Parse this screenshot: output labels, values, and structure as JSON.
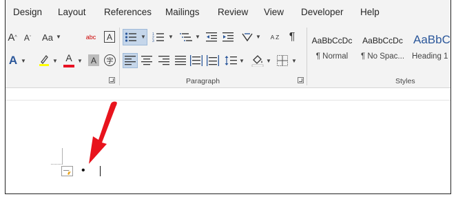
{
  "tabs": [
    "Design",
    "Layout",
    "References",
    "Mailings",
    "Review",
    "View",
    "Developer",
    "Help"
  ],
  "font_group": {
    "change_case_label": "Aa",
    "clear_formatting_label": "abc",
    "char_border_label": "A",
    "text_effects_label": "A",
    "font_color_label": "A",
    "char_shading_label": "A",
    "enclose_label": "字"
  },
  "paragraph_group": {
    "label": "Paragraph",
    "sort_label": "A Z",
    "show_marks_label": "¶"
  },
  "styles_group": {
    "label": "Styles",
    "items": [
      {
        "sample": "AaBbCcDc",
        "name": "¶ Normal"
      },
      {
        "sample": "AaBbCcDc",
        "name": "¶ No Spac..."
      },
      {
        "sample": "AaBbCc",
        "name": "Heading 1"
      }
    ]
  },
  "colors": {
    "accent": "#2b579a",
    "highlight": "#ffff00",
    "font_color": "#e81123",
    "arrow": "#e8141d"
  },
  "document": {
    "bullet": "•"
  }
}
